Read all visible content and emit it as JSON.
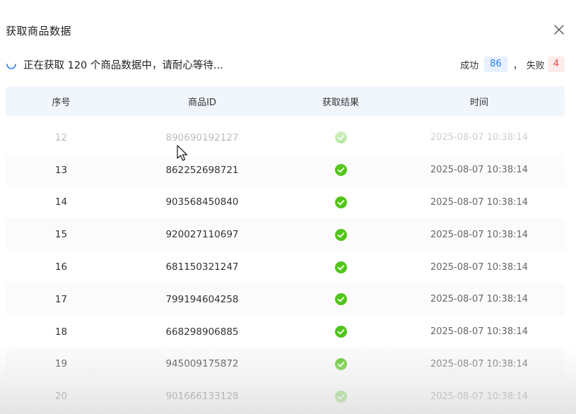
{
  "dialog": {
    "title": "获取商品数据",
    "close_icon": "close-icon"
  },
  "status": {
    "icon": "spinner-icon",
    "text": "正在获取 120 个商品数据中，请耐心等待...",
    "success_label": "成功",
    "success_count": "86",
    "separator": "，",
    "fail_label": "失败",
    "fail_count": "4"
  },
  "colors": {
    "success": "#52c41a",
    "success_text": "#2f7ef5",
    "fail_text": "#e5484d",
    "header_bg": "#f1f6fd"
  },
  "table": {
    "columns": [
      "序号",
      "商品ID",
      "获取结果",
      "时间"
    ],
    "rows": [
      {
        "index": "12",
        "product_id": "890690192127",
        "result": "check-circle-icon",
        "time": "2025-08-07 10:38:14"
      },
      {
        "index": "13",
        "product_id": "862252698721",
        "result": "check-circle-icon",
        "time": "2025-08-07 10:38:14"
      },
      {
        "index": "14",
        "product_id": "903568450840",
        "result": "check-circle-icon",
        "time": "2025-08-07 10:38:14"
      },
      {
        "index": "15",
        "product_id": "920027110697",
        "result": "check-circle-icon",
        "time": "2025-08-07 10:38:14"
      },
      {
        "index": "16",
        "product_id": "681150321247",
        "result": "check-circle-icon",
        "time": "2025-08-07 10:38:14"
      },
      {
        "index": "17",
        "product_id": "799194604258",
        "result": "check-circle-icon",
        "time": "2025-08-07 10:38:14"
      },
      {
        "index": "18",
        "product_id": "668298906885",
        "result": "check-circle-icon",
        "time": "2025-08-07 10:38:14"
      },
      {
        "index": "19",
        "product_id": "945009175872",
        "result": "check-circle-icon",
        "time": "2025-08-07 10:38:14"
      },
      {
        "index": "20",
        "product_id": "901666133128",
        "result": "check-circle-icon",
        "time": "2025-08-07 10:38:14"
      }
    ]
  }
}
